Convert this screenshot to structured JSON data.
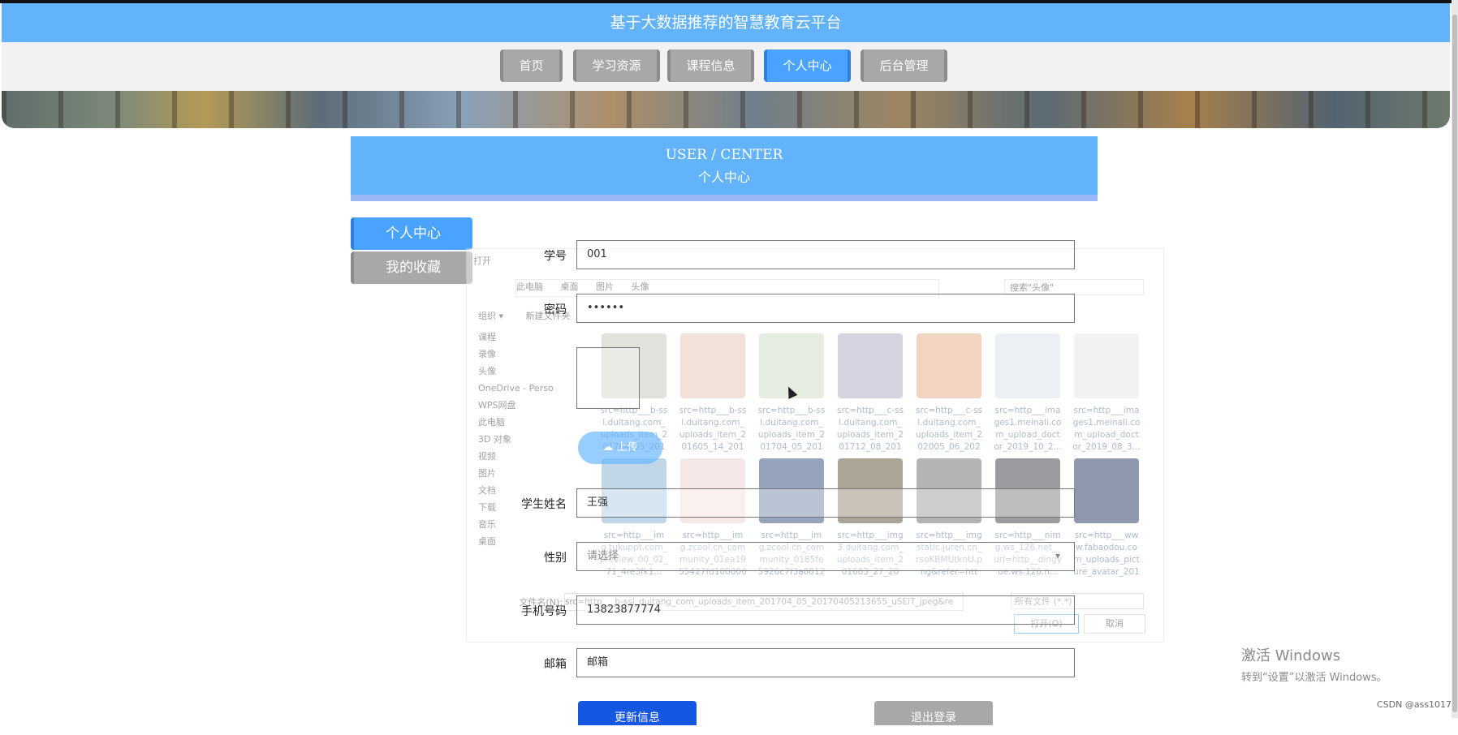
{
  "header": {
    "title": "基于大数据推荐的智慧教育云平台"
  },
  "nav": {
    "items": [
      {
        "label": "首页"
      },
      {
        "label": "学习资源"
      },
      {
        "label": "课程信息"
      },
      {
        "label": "个人中心",
        "active": true
      },
      {
        "label": "后台管理"
      }
    ]
  },
  "user_center": {
    "title_en": "USER / CENTER",
    "title_cn": "个人中心"
  },
  "sidebar": {
    "items": [
      {
        "label": "个人中心",
        "active": true
      },
      {
        "label": "我的收藏"
      }
    ]
  },
  "form": {
    "student_id": {
      "label": "学号",
      "value": "001"
    },
    "password": {
      "label": "密码",
      "value": "••••••"
    },
    "avatar": {
      "upload_label": "上传"
    },
    "student_name": {
      "label": "学生姓名",
      "value": "王强"
    },
    "gender": {
      "label": "性别",
      "placeholder": "请选择"
    },
    "phone": {
      "label": "手机号码",
      "value": "13823877774"
    },
    "email": {
      "label": "邮箱",
      "placeholder": "邮箱"
    },
    "update_button": "更新信息",
    "logout_button": "退出登录"
  },
  "file_dialog": {
    "title": "打开",
    "path": [
      "此电脑",
      "桌面",
      "图片",
      "头像"
    ],
    "search_placeholder": "搜索\"头像\"",
    "toolbar": [
      "组织 ▾",
      "新建文件夹"
    ],
    "tree": [
      "课程",
      "录像",
      "头像",
      "OneDrive - Perso",
      "WPS网盘",
      "此电脑",
      "3D 对象",
      "视频",
      "图片",
      "文档",
      "下载",
      "音乐",
      "桌面"
    ],
    "files": [
      "src=http___b-ssl.duitang.com_uploads_item_201704_05_2017...",
      "src=http___b-ssl.duitang.com_uploads_item_201605_14_2016...",
      "src=http___b-ssl.duitang.com_uploads_item_201704_05_2017...",
      "src=http___c-ssl.duitang.com_uploads_item_201712_08_2017...",
      "src=http___c-ssl.duitang.com_uploads_item_202005_06_2020...",
      "src=http___images1.meinali.com_upload_doctor_2019_10_2...",
      "src=http___images1.meinali.com_upload_doctor_2019_08_3...",
      "src=http___img.tukuppt.com_preview_00_02_71_4re3fk1...",
      "src=http___img.zcool.cn_community_01ea1955427fd10000001...",
      "src=http___img.zcool.cn_community_0185fe5926c7f3a801216...",
      "src=http___img3.duitang.com_uploads_item_201603_27_201...",
      "src=http___imgstatic.juren.cn_rsoKBMUtknU.png&refer=http...",
      "src=http___nimg.ws_126.net__url=http__dingyue.ws.126.n...",
      "src=http___www.fabaodou.com_uploads_picture_avatar_2019..."
    ],
    "filename_label": "文件名(N):",
    "filename_value": "src=http___b-ssl_duitang_com_uploads_item_201704_05_20170405213655_uSEiT_jpeg&re",
    "filter": "所有文件 (*.*)",
    "open_button": "打开(O)",
    "cancel_button": "取消"
  },
  "system": {
    "activate_title": "激活 Windows",
    "activate_sub": "转到“设置”以激活 Windows。",
    "watermark": "CSDN @ass1017"
  },
  "colors": {
    "primary": "#63b3fa",
    "active": "#4aa4ff",
    "inactive": "#a8a8a8",
    "update": "#1557e0"
  }
}
